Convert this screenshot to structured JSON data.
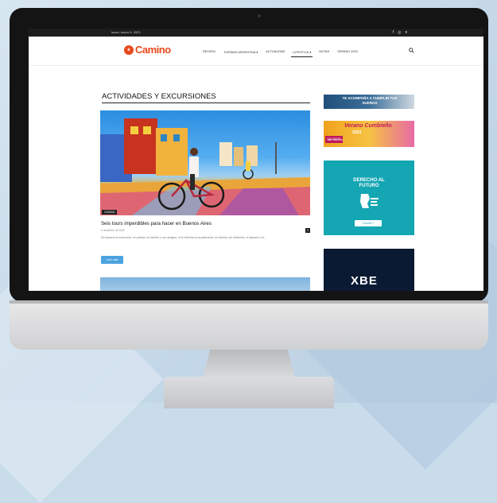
{
  "topbar": {
    "date": "lunes, enero 9, 2023",
    "social": [
      "f",
      "◎",
      "▾"
    ]
  },
  "site": {
    "logo_letter": "e",
    "logo_text": "Camino"
  },
  "nav": {
    "items": [
      "REVISTA",
      "TURISMO ARGENTINA ▾",
      "ACTUALIDAD",
      "LIFESTYLE ▾",
      "NOTAS",
      "VERANO 2023"
    ],
    "active": "LIFESTYLE ▾"
  },
  "main": {
    "section_title": "ACTIVIDADES Y EXCURSIONES",
    "post": {
      "tag": "CIUDAD",
      "title": "Seis tours imperdibles para hacer en Buenos Aires",
      "meta": "5 diciembre de 2022",
      "comments": "0",
      "excerpt": "No importa si sos/a solo, en pareja, en familia o con amigos, si te interesa la arquitectura, la historia, los misterios, el deporte y el...",
      "read_more": "Leer más"
    }
  },
  "sidebar": {
    "ad1_text": "TE ACOMPAÑA A CUMPLIR TUS SUEÑOS",
    "ad2": {
      "title": "Verano Cumbieño",
      "year": "2023",
      "badge": "CALIENTE",
      "sub": "DEL VERANO"
    },
    "ad3": {
      "heading": "DERECHO AL FUTURO",
      "button": "Conocé +"
    },
    "ad4_text": "XBE"
  },
  "colors": {
    "brand": "#e8491d",
    "accent_button": "#4aa3df",
    "teal_ad": "#14a6b3"
  }
}
